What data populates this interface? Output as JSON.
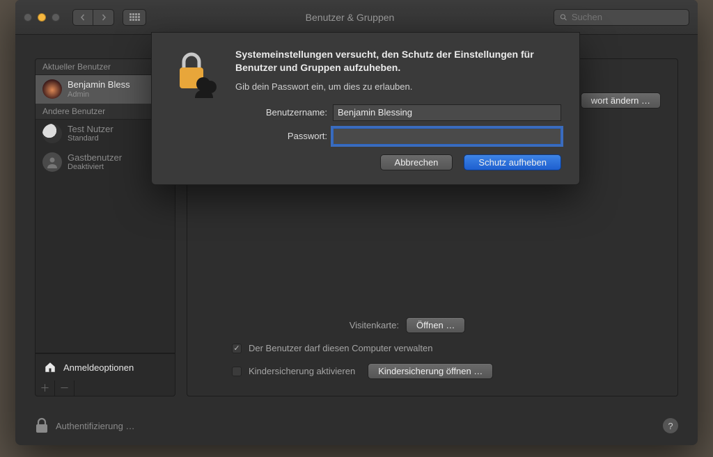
{
  "titlebar": {
    "title": "Benutzer & Gruppen",
    "search_placeholder": "Suchen"
  },
  "sidebar": {
    "current_header": "Aktueller Benutzer",
    "other_header": "Andere Benutzer",
    "users": [
      {
        "name": "Benjamin Bless",
        "role": "Admin"
      },
      {
        "name": "Test Nutzer",
        "role": "Standard"
      },
      {
        "name": "Gastbenutzer",
        "role": "Deaktiviert"
      }
    ],
    "login_options": "Anmeldeoptionen"
  },
  "main": {
    "change_password": "wort ändern …",
    "vcard_label": "Visitenkarte:",
    "vcard_open": "Öffnen …",
    "admin_checkbox": "Der Benutzer darf diesen Computer verwalten",
    "parental_checkbox": "Kindersicherung aktivieren",
    "parental_open": "Kindersicherung öffnen …"
  },
  "footer": {
    "auth": "Authentifizierung …"
  },
  "dialog": {
    "heading": "Systemeinstellungen versucht, den Schutz der Einstellungen für Benutzer und Gruppen aufzuheben.",
    "sub": "Gib dein Passwort ein, um dies zu erlauben.",
    "username_label": "Benutzername:",
    "username_value": "Benjamin Blessing",
    "password_label": "Passwort:",
    "password_value": "",
    "cancel": "Abbrechen",
    "unlock": "Schutz aufheben"
  }
}
